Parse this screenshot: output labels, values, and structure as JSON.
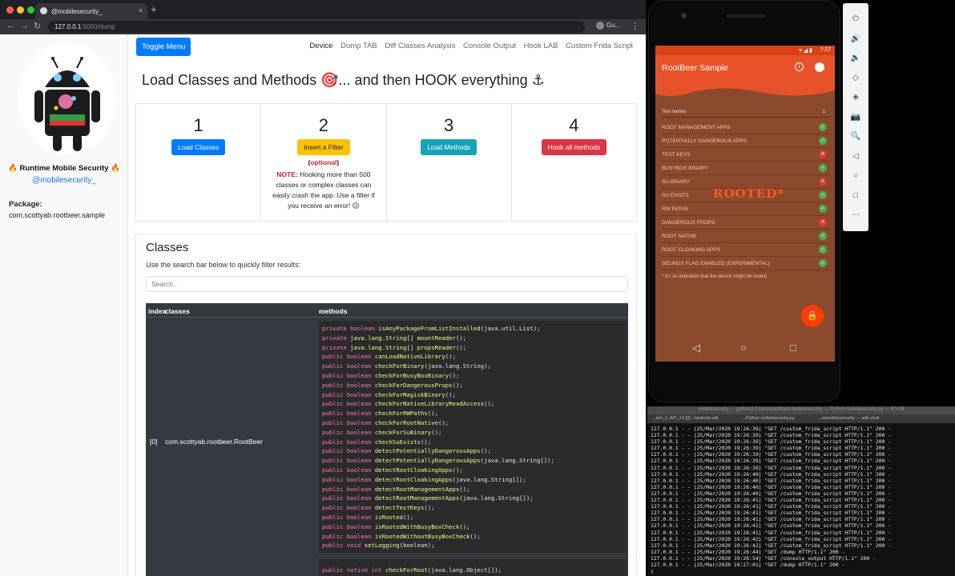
{
  "browser": {
    "tab_title": "@mobilesecurity_",
    "tab_close": "×",
    "new_tab": "+",
    "url_host": "127.0.0.1",
    "url_path": ":5000/dump",
    "profile": "Gu...",
    "nav_back": "←",
    "nav_forward": "→",
    "nav_reload": "↻",
    "menu": "⋮"
  },
  "sidebar": {
    "brand": "🔥 Runtime Mobile Security 🔥",
    "handle": "@mobilesecurity_",
    "package_label": "Package:",
    "package_value": "com.scottyab.rootbeer.sample"
  },
  "header": {
    "toggle_label": "Toggle Menu",
    "nav": [
      "Device",
      "Dump TAB",
      "Diff Classes Analysis",
      "Console Output",
      "Hook LAB",
      "Custom Frida Script"
    ],
    "title": "Load Classes and Methods 🎯... and then HOOK everything ⚓"
  },
  "steps": [
    {
      "num": "1",
      "button": "Load Classes",
      "color": "#007bff"
    },
    {
      "num": "2",
      "button": "Insert a Filter",
      "color": "#ffc107",
      "optional_open": "(",
      "optional_word": "optional",
      "optional_close": ")",
      "note_label": "NOTE:",
      "note_text": " Hooking more than 500 classes or complex classes can easily crash the app. Use a filter if you receive an error! 😉"
    },
    {
      "num": "3",
      "button": "Load Methods",
      "color": "#17a2b8"
    },
    {
      "num": "4",
      "button": "Hook all methods",
      "color": "#dc3545"
    }
  ],
  "classes": {
    "heading": "Classes",
    "subtitle": "Use the search bar below to quickly filter results:",
    "search_placeholder": "Search..",
    "columns": [
      "index",
      "classes",
      "methods"
    ],
    "row": {
      "index": "[0]",
      "class_name": "com.scottyab.rootbeer.RootBeer",
      "methods": [
        [
          "private boolean ",
          "isAnyPackageFromListInstalled",
          "(java.util.List);"
        ],
        [
          "private ",
          "java.lang.String[] mountReader",
          "();"
        ],
        [
          "private ",
          "java.lang.String[] propsReader",
          "();"
        ],
        [
          "public boolean ",
          "canLoadNativeLibrary",
          "();"
        ],
        [
          "public boolean ",
          "checkForBinary",
          "(java.lang.String);"
        ],
        [
          "public boolean ",
          "checkForBusyBoxBinary",
          "();"
        ],
        [
          "public boolean ",
          "checkForDangerousProps",
          "();"
        ],
        [
          "public boolean ",
          "checkForMagiskBinary",
          "();"
        ],
        [
          "public boolean ",
          "checkForNativeLibraryReadAccess",
          "();"
        ],
        [
          "public boolean ",
          "checkForRWPaths",
          "();"
        ],
        [
          "public boolean ",
          "checkForRootNative",
          "();"
        ],
        [
          "public boolean ",
          "checkForSuBinary",
          "();"
        ],
        [
          "public boolean ",
          "checkSuExists",
          "();"
        ],
        [
          "public boolean ",
          "detectPotentiallyDangerousApps",
          "();"
        ],
        [
          "public boolean ",
          "detectPotentiallyDangerousApps",
          "(java.lang.String[]);"
        ],
        [
          "public boolean ",
          "detectRootCloakingApps",
          "();"
        ],
        [
          "public boolean ",
          "detectRootCloakingApps",
          "(java.lang.String[]);"
        ],
        [
          "public boolean ",
          "detectRootManagementApps",
          "();"
        ],
        [
          "public boolean ",
          "detectRootManagementApps",
          "(java.lang.String[]);"
        ],
        [
          "public boolean ",
          "detectTestKeys",
          "();"
        ],
        [
          "public boolean ",
          "isRooted",
          "();"
        ],
        [
          "public boolean ",
          "isRootedWithBusyBoxCheck",
          "();"
        ],
        [
          "public boolean ",
          "isRootedWithoutBusyBoxCheck",
          "();"
        ],
        [
          "public void ",
          "setLogging",
          "(boolean);"
        ]
      ]
    },
    "next_row_first": [
      "public native int ",
      "checkForRoot",
      "(java.lang.Object[]);"
    ]
  },
  "android": {
    "status_time": "7:27",
    "status_icons": "▾ ◢ ▮",
    "app_title": "RootBeer Sample",
    "info_icon_glyph": "i",
    "list_header": "Test names",
    "list_header_mark": "1",
    "tests": [
      {
        "name": "ROOT MANAGEMENT APPS",
        "ok": true
      },
      {
        "name": "POTENTIALLY DANGEROUS APPS",
        "ok": true
      },
      {
        "name": "TEST KEYS",
        "ok": false
      },
      {
        "name": "BUSYBOX BINARY",
        "ok": true
      },
      {
        "name": "SU BINARY",
        "ok": false
      },
      {
        "name": "SU EXISTS",
        "ok": true
      },
      {
        "name": "RW PATHS",
        "ok": true
      },
      {
        "name": "DANGEROUS PROPS",
        "ok": false
      },
      {
        "name": "ROOT NATIVE",
        "ok": true
      },
      {
        "name": "ROOT CLOAKING APPS",
        "ok": true
      },
      {
        "name": "SELINUX FLAG ENABLED (EXPERIMENTAL)",
        "ok": true
      }
    ],
    "ok_glyph": "✓",
    "bad_glyph": "✕",
    "verdict": "ROOTED*",
    "footnote": "* It's an indication that the device might be rooted",
    "fab_glyph": "🔒",
    "nav_back": "◁",
    "nav_home": "○",
    "nav_recents": "□"
  },
  "emulator": {
    "buttons": [
      "⏻",
      "🔊",
      "🔉",
      "◇",
      "◈",
      "📷",
      "🔍",
      "◁",
      "○",
      "□",
      "⋯"
    ]
  },
  "terminal": {
    "title": "mobilesecurity — python3 /Users/paul/tools/mobilesecurity — Python mobilesecurity.py — 97×26",
    "tabs": [
      "...ixel_2_API_24 [0] ~/android-sdk",
      "...Python mobilesecurity.py",
      "...ia/mobilesecurity — adb shell"
    ],
    "lines": [
      "127.0.0.1 - - [25/Mar/2020 19:26:39] \"GET /custom_frida_script HTTP/1.1\" 200 -",
      "127.0.0.1 - - [25/Mar/2020 19:26:39] \"GET /custom_frida_script HTTP/1.1\" 200 -",
      "127.0.0.1 - - [25/Mar/2020 19:26:39] \"GET /custom_frida_script HTTP/1.1\" 200 -",
      "127.0.0.1 - - [25/Mar/2020 19:26:39] \"GET /custom_frida_script HTTP/1.1\" 200 -",
      "127.0.0.1 - - [25/Mar/2020 19:26:39] \"GET /custom_frida_script HTTP/1.1\" 200 -",
      "127.0.0.1 - - [25/Mar/2020 19:26:39] \"GET /custom_frida_script HTTP/1.1\" 200 -",
      "127.0.0.1 - - [25/Mar/2020 19:26:39] \"GET /custom_frida_script HTTP/1.1\" 200 -",
      "127.0.0.1 - - [25/Mar/2020 19:26:40] \"GET /custom_frida_script HTTP/1.1\" 200 -",
      "127.0.0.1 - - [25/Mar/2020 19:26:40] \"GET /custom_frida_script HTTP/1.1\" 200 -",
      "127.0.0.1 - - [25/Mar/2020 19:26:40] \"GET /custom_frida_script HTTP/1.1\" 200 -",
      "127.0.0.1 - - [25/Mar/2020 19:26:40] \"GET /custom_frida_script HTTP/1.1\" 200 -",
      "127.0.0.1 - - [25/Mar/2020 19:26:41] \"GET /custom_frida_script HTTP/1.1\" 200 -",
      "127.0.0.1 - - [25/Mar/2020 19:26:41] \"GET /custom_frida_script HTTP/1.1\" 200 -",
      "127.0.0.1 - - [25/Mar/2020 19:26:41] \"GET /custom_frida_script HTTP/1.1\" 200 -",
      "127.0.0.1 - - [25/Mar/2020 19:26:41] \"GET /custom_frida_script HTTP/1.1\" 200 -",
      "127.0.0.1 - - [25/Mar/2020 19:26:41] \"GET /custom_frida_script HTTP/1.1\" 200 -",
      "127.0.0.1 - - [25/Mar/2020 19:26:41] \"GET /custom_frida_script HTTP/1.1\" 200 -",
      "127.0.0.1 - - [25/Mar/2020 19:26:42] \"GET /custom_frida_script HTTP/1.1\" 200 -",
      "127.0.0.1 - - [25/Mar/2020 19:26:42] \"GET /custom_frida_script HTTP/1.1\" 200 -",
      "127.0.0.1 - - [25/Mar/2020 19:26:44] \"GET /dump HTTP/1.1\" 200 -",
      "127.0.0.1 - - [25/Mar/2020 19:26:54] \"GET /console_output HTTP/1.1\" 200 -",
      "127.0.0.1 - - [25/Mar/2020 19:27:01] \"GET /dump HTTP/1.1\" 200 -",
      "▯"
    ]
  }
}
